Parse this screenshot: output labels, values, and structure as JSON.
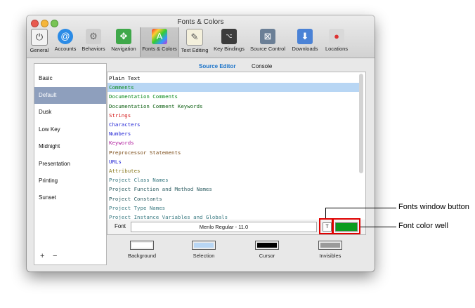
{
  "window": {
    "title": "Fonts & Colors"
  },
  "toolbar": {
    "items": [
      {
        "label": "General",
        "icon": "general-switch-icon"
      },
      {
        "label": "Accounts",
        "icon": "at-sign-icon"
      },
      {
        "label": "Behaviors",
        "icon": "gears-icon"
      },
      {
        "label": "Navigation",
        "icon": "arrows-icon"
      },
      {
        "label": "Fonts & Colors",
        "icon": "color-letter-icon"
      },
      {
        "label": "Text Editing",
        "icon": "pencil-paper-icon"
      },
      {
        "label": "Key Bindings",
        "icon": "option-key-icon"
      },
      {
        "label": "Source Control",
        "icon": "source-control-icon"
      },
      {
        "label": "Downloads",
        "icon": "download-tray-icon"
      },
      {
        "label": "Locations",
        "icon": "joystick-icon"
      }
    ],
    "selected_index": 4
  },
  "themes": {
    "items": [
      "Basic",
      "Default",
      "Dusk",
      "Low Key",
      "Midnight",
      "Presentation",
      "Printing",
      "Sunset"
    ],
    "selected_index": 1,
    "add_label": "+",
    "remove_label": "−"
  },
  "tabs": {
    "items": [
      "Source Editor",
      "Console"
    ],
    "active_index": 0
  },
  "syntax": [
    {
      "label": "Plain Text",
      "color": "#000000"
    },
    {
      "label": "Comments",
      "color": "#0a8a1a"
    },
    {
      "label": "Documentation Comments",
      "color": "#0a8a1a"
    },
    {
      "label": "Documentation Comment Keywords",
      "color": "#0b5e10"
    },
    {
      "label": "Strings",
      "color": "#d41a1a"
    },
    {
      "label": "Characters",
      "color": "#1c1fd4"
    },
    {
      "label": "Numbers",
      "color": "#1c1fd4"
    },
    {
      "label": "Keywords",
      "color": "#b01f9e"
    },
    {
      "label": "Preprocessor Statements",
      "color": "#7a4a15"
    },
    {
      "label": "URLs",
      "color": "#1c1fd4"
    },
    {
      "label": "Attributes",
      "color": "#8a7a20"
    },
    {
      "label": "Project Class Names",
      "color": "#3a7a82"
    },
    {
      "label": "Project Function and Method Names",
      "color": "#2d5d62"
    },
    {
      "label": "Project Constants",
      "color": "#2d5d62"
    },
    {
      "label": "Project Type Names",
      "color": "#3a7a82"
    },
    {
      "label": "Project Instance Variables and Globals",
      "color": "#3a7a82"
    }
  ],
  "syntax_selected_index": 1,
  "font": {
    "label": "Font",
    "value": "Menlo Regular - 11.0",
    "button_icon": "fonts-window-icon",
    "color_well": "#0a9b1f"
  },
  "swatches": [
    {
      "label": "Background",
      "color": "#ffffff"
    },
    {
      "label": "Selection",
      "color": "#b8d6f4"
    },
    {
      "label": "Cursor",
      "color": "#000000"
    },
    {
      "label": "Invisibles",
      "color": "#9a9a9a"
    }
  ],
  "callouts": {
    "fonts_window_button": "Fonts window button",
    "font_color_well": "Font color well"
  }
}
